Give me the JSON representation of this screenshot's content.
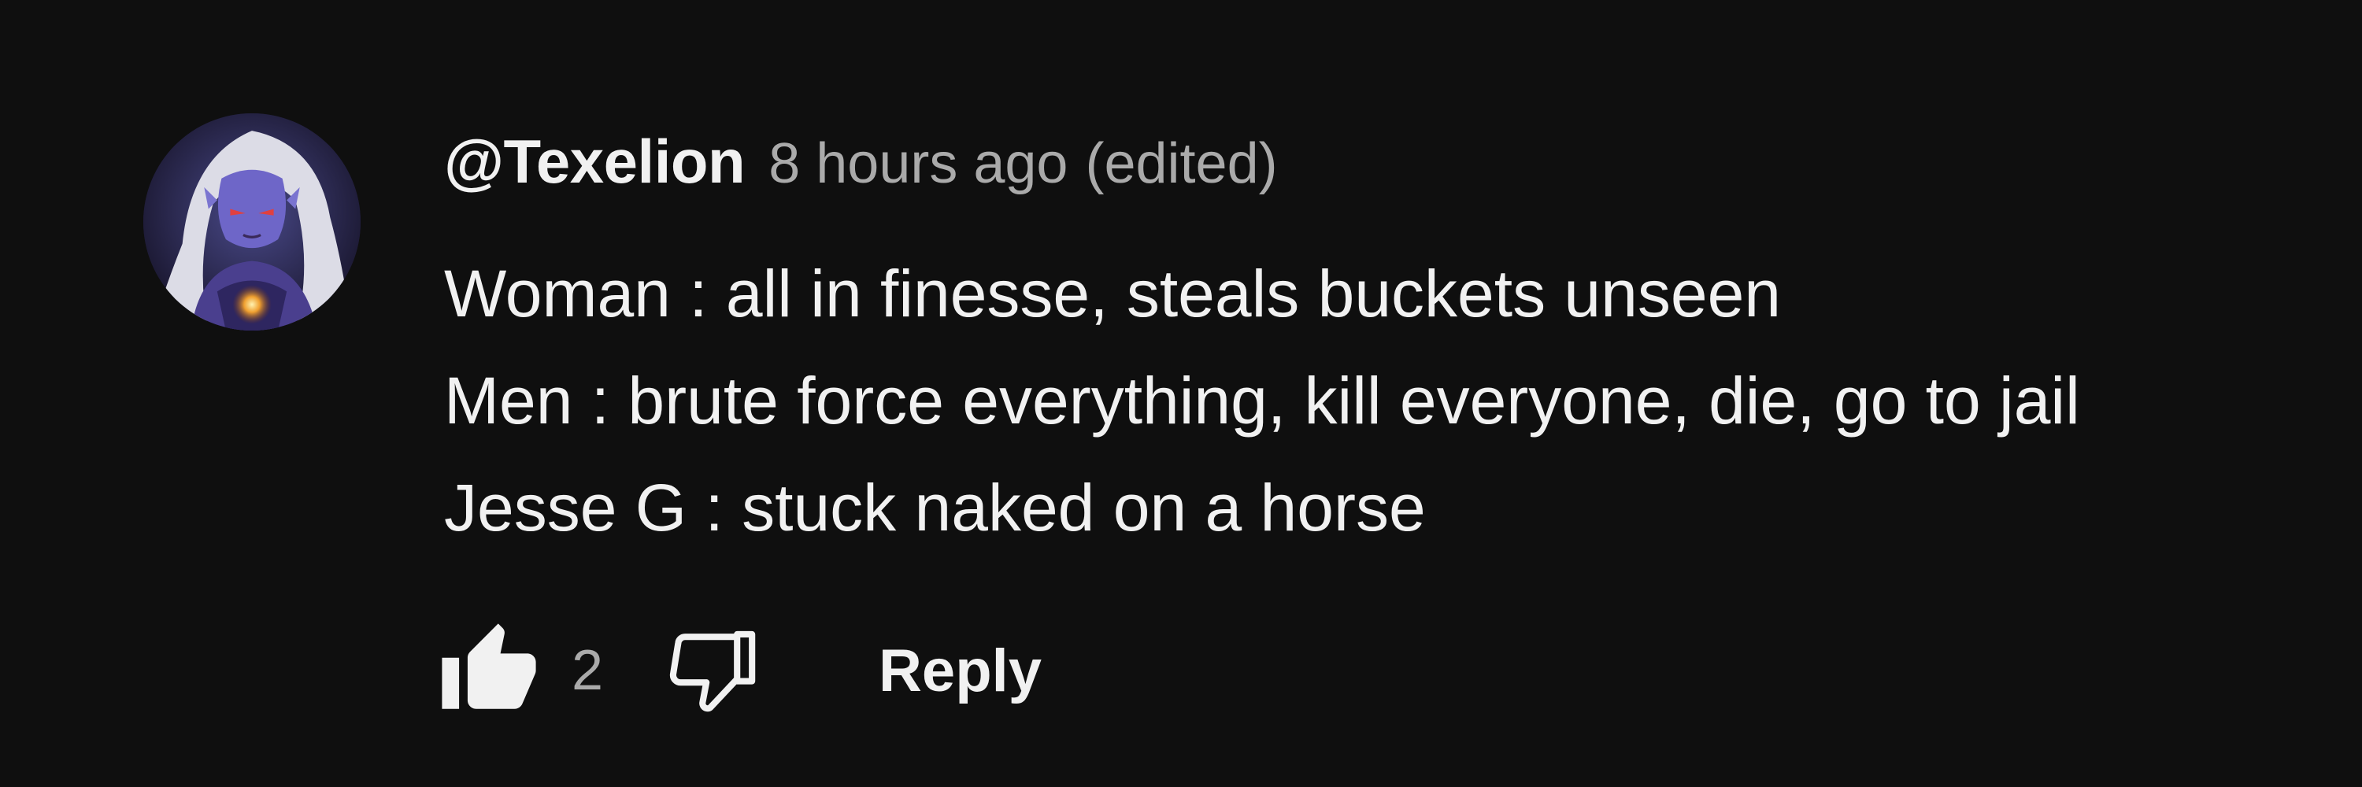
{
  "comment": {
    "author": "@Texelion",
    "time": "8 hours ago",
    "edited": "(edited)",
    "lines": [
      "Woman : all in finesse, steals buckets unseen",
      "Men : brute force everything, kill everyone, die, go to jail",
      "Jesse G : stuck naked on a horse"
    ],
    "avatar_icon": "avatar-image",
    "like_icon": "thumbs-up-icon",
    "dislike_icon": "thumbs-down-icon",
    "like_count": "2",
    "reply_label": "Reply"
  },
  "colors": {
    "background": "#0f0f0f",
    "primary_text": "#f1f1f1",
    "secondary_text": "#aaaaaa"
  }
}
